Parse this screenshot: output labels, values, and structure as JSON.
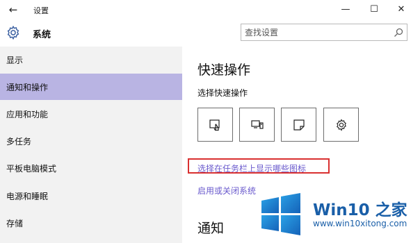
{
  "window": {
    "title": "设置",
    "back_glyph": "←",
    "minimize_glyph": "—",
    "maximize_glyph": "☐",
    "close_glyph": "✕"
  },
  "header": {
    "section_title": "系统",
    "search_placeholder": "查找设置"
  },
  "sidebar": {
    "items": [
      {
        "label": "显示",
        "selected": false
      },
      {
        "label": "通知和操作",
        "selected": true
      },
      {
        "label": "应用和功能",
        "selected": false
      },
      {
        "label": "多任务",
        "selected": false
      },
      {
        "label": "平板电脑模式",
        "selected": false
      },
      {
        "label": "电源和睡眠",
        "selected": false
      },
      {
        "label": "存储",
        "selected": false
      }
    ]
  },
  "main": {
    "quick_actions_title": "快速操作",
    "quick_actions_subtitle": "选择快速操作",
    "tiles": [
      {
        "icon": "tablet-mode-icon"
      },
      {
        "icon": "project-icon"
      },
      {
        "icon": "note-icon"
      },
      {
        "icon": "settings-icon"
      }
    ],
    "link_taskbar_icons": "选择在任务栏上显示哪些图标",
    "link_system_icons": "启用或关闭系统",
    "notifications_title": "通知"
  },
  "watermark": {
    "brand": "Win10 之家",
    "url": "www.win10xitong.com"
  },
  "colors": {
    "selected_bg": "#b9b4e3",
    "link": "#6a5acd",
    "highlight_border": "#d93030",
    "watermark": "#1a5fa8"
  }
}
